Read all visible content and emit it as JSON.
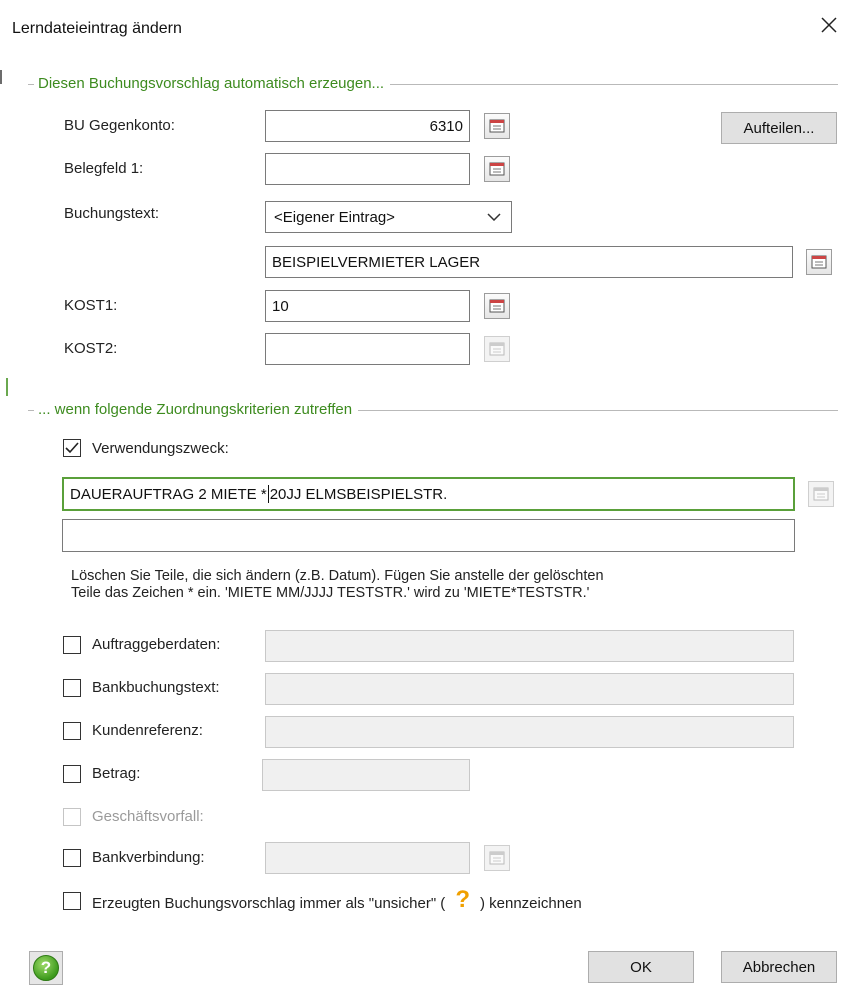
{
  "dialog": {
    "title": "Lerndateieintrag ändern",
    "close_symbol": "✕"
  },
  "group1": {
    "label": "Diesen Buchungsvorschlag automatisch erzeugen...",
    "bu_gegenkonto_label": "BU Gegenkonto:",
    "bu_gegenkonto_value": "6310",
    "aufteilen_button": "Aufteilen...",
    "belegfeld_label": "Belegfeld 1:",
    "belegfeld_value": "",
    "buchungstext_label": "Buchungstext:",
    "buchungstext_selected": "<Eigener Eintrag>",
    "buchungstext_value": "BEISPIELVERMIETER LAGER",
    "kost1_label": "KOST1:",
    "kost1_value": "10",
    "kost2_label": "KOST2:",
    "kost2_value": ""
  },
  "group2": {
    "label": "... wenn folgende Zuordnungskriterien zutreffen",
    "verwendungszweck_label": "Verwendungszweck:",
    "verwendungszweck_checked": true,
    "verwendungszweck_line1_before_caret": "DAUERAUFTRAG 2 MIETE *",
    "verwendungszweck_line1_after_caret": "20JJ  ELMSBEISPIELSTR.",
    "verwendungszweck_line2": "",
    "hint_line1": "Löschen Sie Teile, die sich ändern (z.B. Datum). Fügen Sie anstelle der gelöschten",
    "hint_line2": "Teile das Zeichen * ein. 'MIETE MM/JJJJ TESTSTR.' wird zu 'MIETE*TESTSTR.'",
    "auftraggeberdaten_label": "Auftraggeberdaten:",
    "bankbuchungstext_label": "Bankbuchungstext:",
    "kundenreferenz_label": "Kundenreferenz:",
    "betrag_label": "Betrag:",
    "geschaeftsvorfall_label": "Geschäftsvorfall:",
    "bankverbindung_label": "Bankverbindung:",
    "unsicher_label_before": "Erzeugten Buchungsvorschlag immer als \"unsicher\" (",
    "unsicher_symbol": "?",
    "unsicher_label_after": ") kennzeichnen"
  },
  "footer": {
    "help_symbol": "?",
    "ok_button": "OK",
    "cancel_button": "Abbrechen"
  },
  "colors": {
    "group_label": "#3d8b1f",
    "active_border": "#5aa03a",
    "warning_icon": "#f0a000"
  }
}
